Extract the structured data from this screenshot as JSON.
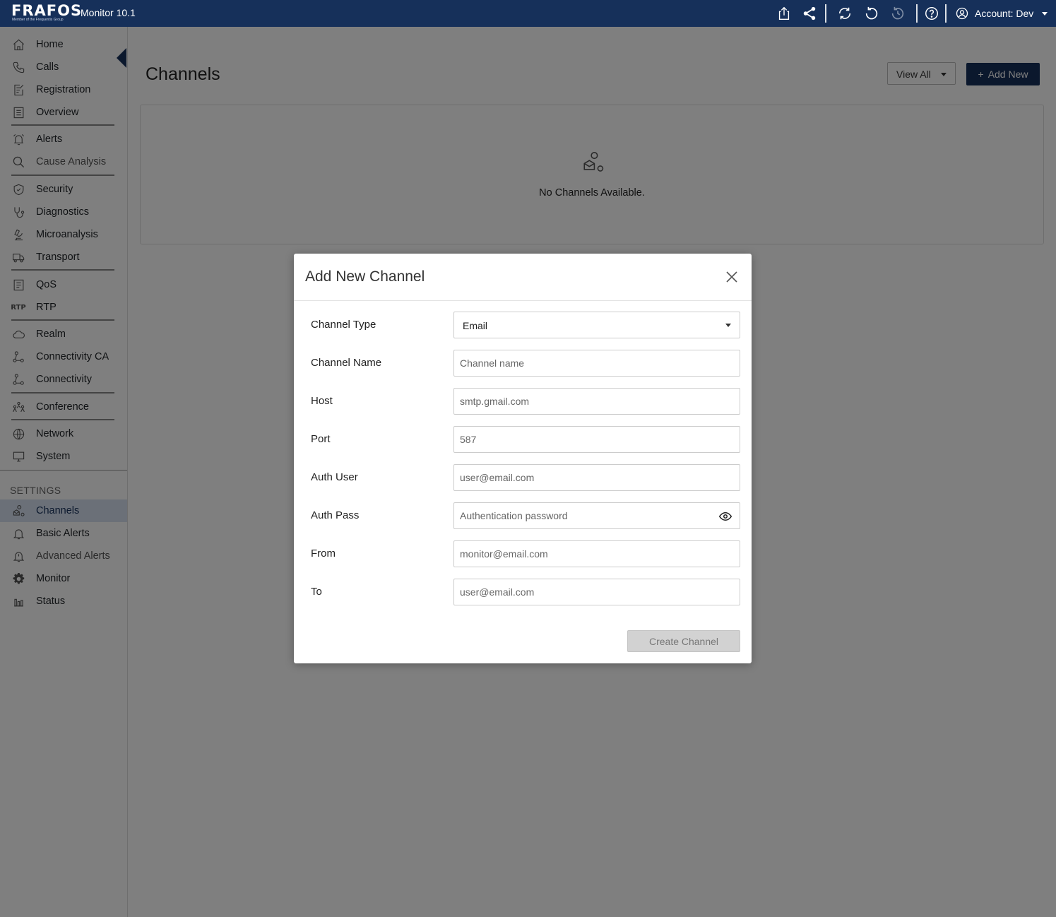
{
  "app": {
    "logo_text": "FRAFOS",
    "logo_subtext": "Member of the Frequentis Group",
    "title": "Monitor 10.1",
    "account_label": "Account: Dev"
  },
  "toolbar_icons": [
    "export-icon",
    "share-icon",
    "refresh-icon",
    "reset-icon",
    "history-icon",
    "help-icon",
    "user-icon"
  ],
  "sidebar": {
    "items": [
      {
        "label": "Home",
        "icon": "home-icon"
      },
      {
        "label": "Calls",
        "icon": "phone-icon"
      },
      {
        "label": "Registration",
        "icon": "registration-icon"
      },
      {
        "label": "Overview",
        "icon": "overview-icon"
      },
      {
        "label": "Alerts",
        "icon": "alarm-icon"
      },
      {
        "label": "Cause Analysis",
        "icon": "search-icon"
      },
      {
        "label": "Security",
        "icon": "shield-icon"
      },
      {
        "label": "Diagnostics",
        "icon": "stethoscope-icon"
      },
      {
        "label": "Microanalysis",
        "icon": "microscope-icon"
      },
      {
        "label": "Transport",
        "icon": "truck-icon"
      },
      {
        "label": "QoS",
        "icon": "qos-icon"
      },
      {
        "label": "RTP",
        "icon": "rtp-icon"
      },
      {
        "label": "Realm",
        "icon": "cloud-icon"
      },
      {
        "label": "Connectivity CA",
        "icon": "connectivity-icon"
      },
      {
        "label": "Connectivity",
        "icon": "connectivity-icon"
      },
      {
        "label": "Conference",
        "icon": "conference-icon"
      },
      {
        "label": "Network",
        "icon": "globe-icon"
      },
      {
        "label": "System",
        "icon": "monitor-icon"
      }
    ],
    "settings_heading": "SETTINGS",
    "settings_items": [
      {
        "label": "Channels",
        "icon": "channels-icon",
        "active": true
      },
      {
        "label": "Basic Alerts",
        "icon": "bell-icon"
      },
      {
        "label": "Advanced Alerts",
        "icon": "bell-outline-icon"
      },
      {
        "label": "Monitor",
        "icon": "gear-icon"
      },
      {
        "label": "Status",
        "icon": "bar-chart-icon"
      }
    ]
  },
  "page": {
    "title": "Channels",
    "view_all_label": "View All",
    "add_new_label": "Add New",
    "empty_text": "No Channels Available."
  },
  "modal": {
    "title": "Add New Channel",
    "fields": {
      "channel_type": {
        "label": "Channel Type",
        "value": "Email"
      },
      "channel_name": {
        "label": "Channel Name",
        "placeholder": "Channel name"
      },
      "host": {
        "label": "Host",
        "placeholder": "smtp.gmail.com"
      },
      "port": {
        "label": "Port",
        "placeholder": "587"
      },
      "auth_user": {
        "label": "Auth User",
        "placeholder": "user@email.com"
      },
      "auth_pass": {
        "label": "Auth Pass",
        "placeholder": "Authentication password"
      },
      "from": {
        "label": "From",
        "placeholder": "monitor@email.com"
      },
      "to": {
        "label": "To",
        "placeholder": "user@email.com"
      }
    },
    "submit_label": "Create Channel"
  },
  "colors": {
    "brand": "#16305a",
    "active_nav_bg": "#d6e1f0",
    "overlay": "rgba(0,0,0,0.5)"
  }
}
